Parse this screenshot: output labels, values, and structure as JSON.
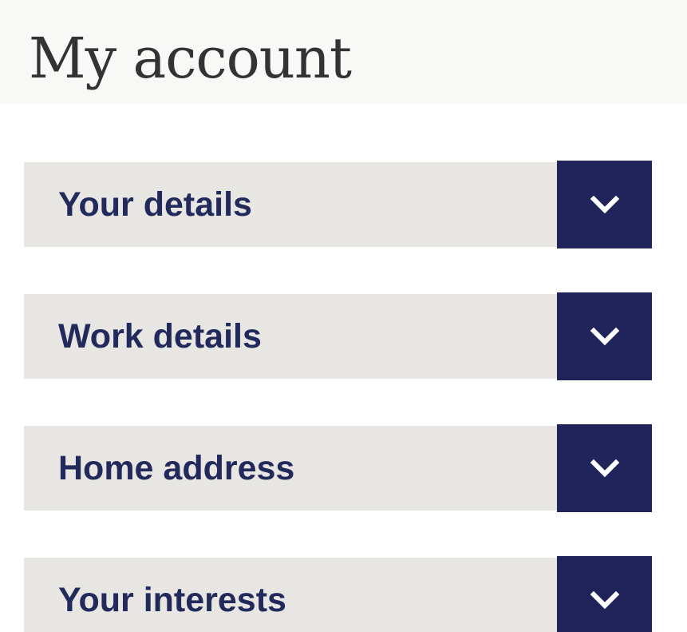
{
  "header": {
    "title": "My account"
  },
  "accordion": {
    "items": [
      {
        "label": "Your details",
        "icon": "chevron-down-icon"
      },
      {
        "label": "Work details",
        "icon": "chevron-down-icon"
      },
      {
        "label": "Home address",
        "icon": "chevron-down-icon"
      },
      {
        "label": "Your interests",
        "icon": "chevron-down-icon"
      }
    ]
  },
  "colors": {
    "header_background": "#f8f8f7",
    "title_text": "#333333",
    "accordion_bar": "#e8e6e3",
    "accordion_text": "#222a5c",
    "toggle_button": "#20245a",
    "toggle_icon": "#ffffff"
  }
}
